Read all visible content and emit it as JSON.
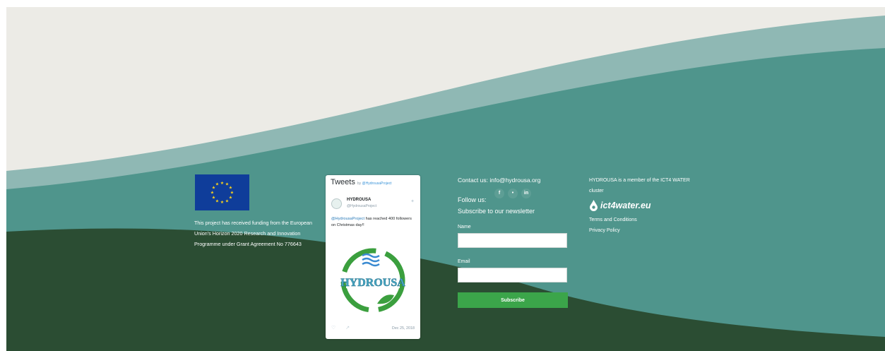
{
  "colors": {
    "paper": "#ecebe6",
    "teal_light": "#8fb8b4",
    "teal": "#4f958c",
    "forest": "#2b4d33",
    "eu_blue": "#0f3d9a",
    "eu_star": "#ffd617",
    "subscribe_green": "#3ba54a"
  },
  "funding": {
    "flag_icon": "eu-flag-icon",
    "text": "This project has received funding from the European Union's Horizon 2020 Research and Innovation Programme under Grant Agreement No 776643"
  },
  "tweets": {
    "title": "Tweets",
    "by_label": "by",
    "by_handle": "@HydrousaProject",
    "tweet": {
      "author": "HYDROUSA",
      "handle": "@HydrousaProject",
      "mention": "@HydrousaProject",
      "text": " has reached 400 followers on Christmas day!!",
      "image_alt": "HYDROUSA",
      "date": "Dec 25, 2018"
    }
  },
  "contact": {
    "label": "Contact us: info@hydrousa.org",
    "follow_label": "Follow us:",
    "social_icons": [
      "facebook-icon",
      "twitter-icon",
      "linkedin-icon"
    ],
    "social_glyphs": [
      "f",
      "•",
      "in"
    ]
  },
  "newsletter": {
    "title": "Subscribe to our newsletter",
    "name_label": "Name",
    "name_value": "",
    "email_label": "Email",
    "email_value": "",
    "button_label": "Subscribe"
  },
  "member": {
    "text": "HYDROUSA is a member of the ICT4 WATER cluster",
    "logo_text": "ict4water.eu",
    "terms_label": "Terms and Conditions",
    "privacy_label": "Privacy Policy"
  }
}
